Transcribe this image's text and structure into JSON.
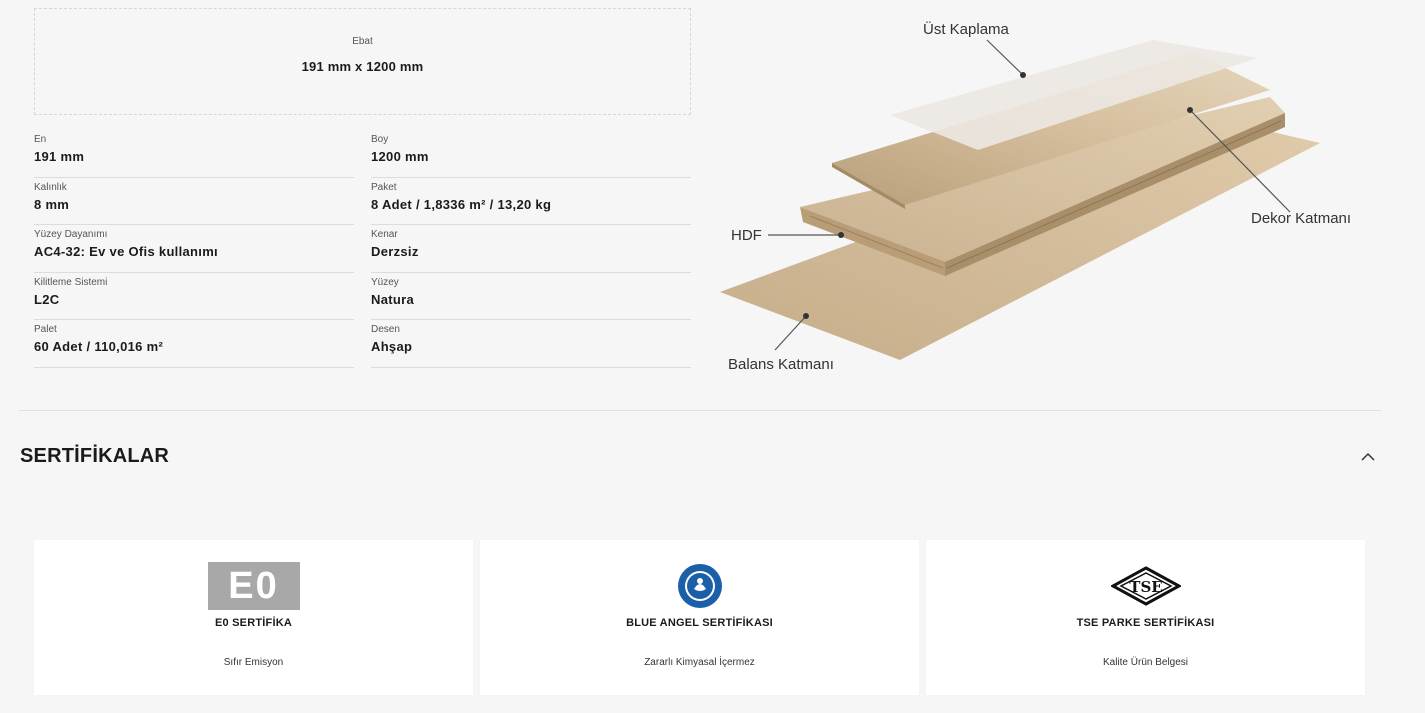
{
  "ebat": {
    "label": "Ebat",
    "value": "191 mm x 1200 mm"
  },
  "specs": [
    {
      "label": "En",
      "value": "191 mm"
    },
    {
      "label": "Boy",
      "value": "1200 mm"
    },
    {
      "label": "Kalınlık",
      "value": "8 mm"
    },
    {
      "label": "Paket",
      "value": "8 Adet / 1,8336 m² / 13,20 kg"
    },
    {
      "label": "Yüzey Dayanımı",
      "value": "AC4-32: Ev ve Ofis kullanımı"
    },
    {
      "label": "Kenar",
      "value": "Derzsiz"
    },
    {
      "label": "Kilitleme Sistemi",
      "value": "L2C"
    },
    {
      "label": "Yüzey",
      "value": "Natura"
    },
    {
      "label": "Palet",
      "value": "60 Adet / 110,016 m²"
    },
    {
      "label": "Desen",
      "value": "Ahşap"
    }
  ],
  "diagram": {
    "labels": {
      "top": "Üst Kaplama",
      "decor": "Dekor Katmanı",
      "hdf": "HDF",
      "balance": "Balans Katmanı"
    }
  },
  "certifications": {
    "title": "SERTİFİKALAR",
    "toggle_icon": "chevron-up-icon",
    "cards": [
      {
        "logo_text": "E0",
        "icon": "e0-logo-icon",
        "title": "E0 SERTİFİKA",
        "subtitle": "Sıfır Emisyon"
      },
      {
        "icon": "blue-angel-logo-icon",
        "title": "BLUE ANGEL SERTİFİKASI",
        "subtitle": "Zararlı Kimyasal İçermez",
        "color": "#1a5fa8"
      },
      {
        "logo_text": "TSE",
        "icon": "tse-logo-icon",
        "title": "TSE PARKE SERTİFİKASI",
        "subtitle": "Kalite Ürün Belgesi"
      }
    ]
  }
}
